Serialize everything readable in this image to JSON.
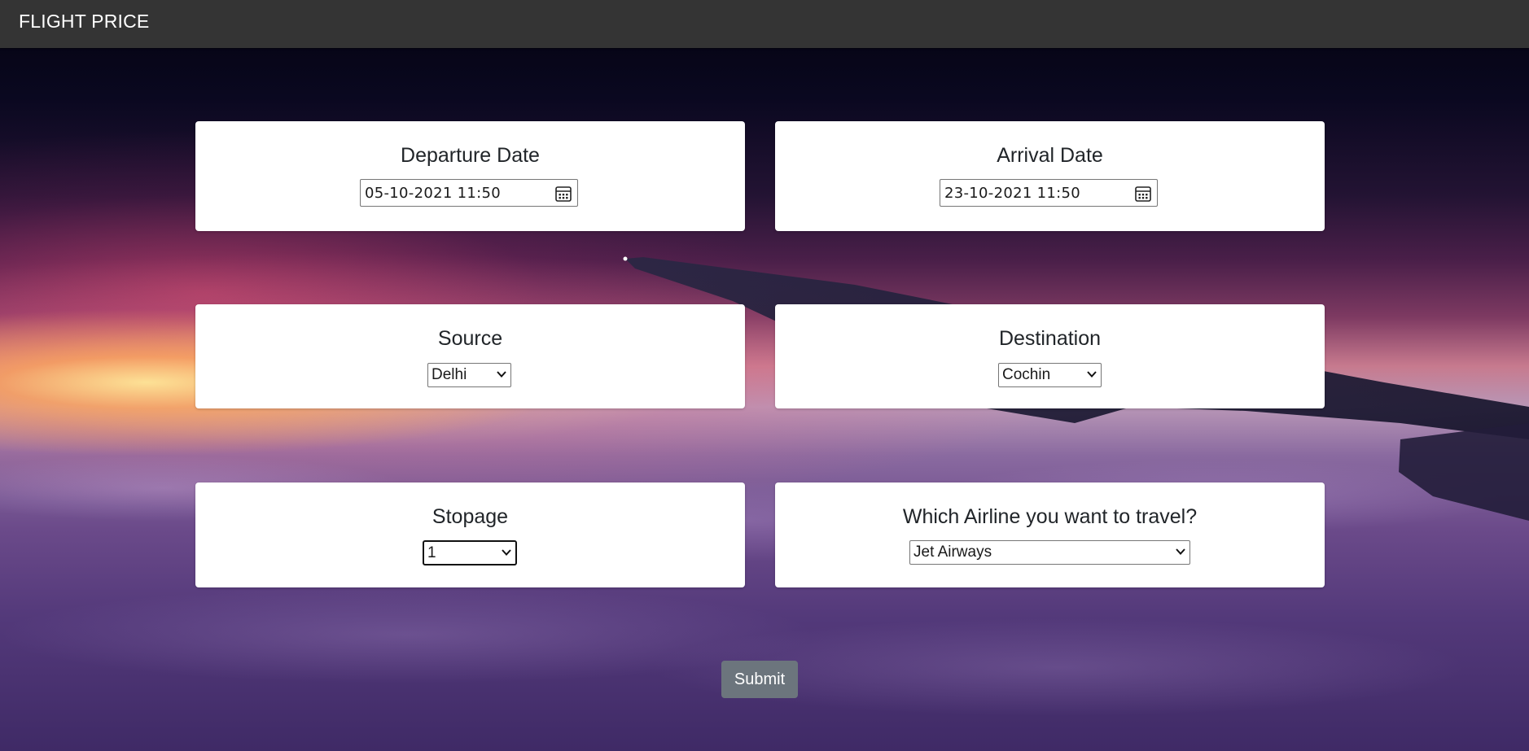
{
  "navbar": {
    "brand": "FLIGHT PRICE"
  },
  "departure": {
    "label": "Departure Date",
    "value": "05-10-2021 11:50"
  },
  "arrival": {
    "label": "Arrival Date",
    "value": "23-10-2021 11:50"
  },
  "source": {
    "label": "Source",
    "selected": "Delhi"
  },
  "destination": {
    "label": "Destination",
    "selected": "Cochin"
  },
  "stopage": {
    "label": "Stopage",
    "selected": "1"
  },
  "airline": {
    "label": "Which Airline you want to travel?",
    "selected": "Jet Airways"
  },
  "submit": {
    "label": "Submit"
  },
  "colors": {
    "navbar_bg": "#343434",
    "submit_bg": "#6c757d",
    "card_bg": "#ffffff"
  },
  "icons": {
    "date_picker": "calendar-icon",
    "select": "chevron-down-icon"
  }
}
